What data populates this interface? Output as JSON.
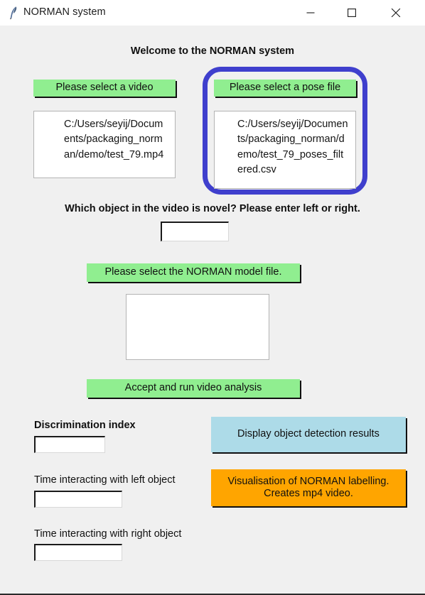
{
  "window": {
    "title": "NORMAN system",
    "icon": "feather-icon",
    "controls": {
      "minimize": "minimize-icon",
      "maximize": "maximize-icon",
      "close": "close-icon"
    }
  },
  "main": {
    "heading": "Welcome to the NORMAN system",
    "video": {
      "button_label": "Please select a video",
      "path_value": "C:/Users/seyij/Documents/packaging_norman/demo/test_79.mp4"
    },
    "pose": {
      "button_label": "Please select a pose file",
      "path_value": "C:/Users/seyij/Documents/packaging_norman/demo/test_79_poses_filtered.csv",
      "highlighted": true,
      "highlight_color": "#3f3fcd"
    },
    "novel_object": {
      "question": "Which object in the video is novel? Please enter left or right.",
      "input_value": "",
      "input_placeholder": ""
    },
    "model": {
      "button_label": "Please select the NORMAN model file.",
      "path_value": ""
    },
    "run": {
      "button_label": "Accept and run video analysis"
    },
    "results": {
      "discrimination_index": {
        "label": "Discrimination index",
        "value": ""
      },
      "time_left": {
        "label": "Time interacting with left object",
        "value": ""
      },
      "time_right": {
        "label": "Time interacting with right object",
        "value": ""
      }
    },
    "actions": {
      "detection_label": "Display object detection results",
      "visualisation_label": "Visualisation of NORMAN labelling.\nCreates mp4 video."
    }
  },
  "colors": {
    "green_button": "#90ee90",
    "blue_button": "#addbe8",
    "orange_button": "#ffa500",
    "highlight_ring": "#3f3fcd",
    "background": "#f0f0f0"
  }
}
